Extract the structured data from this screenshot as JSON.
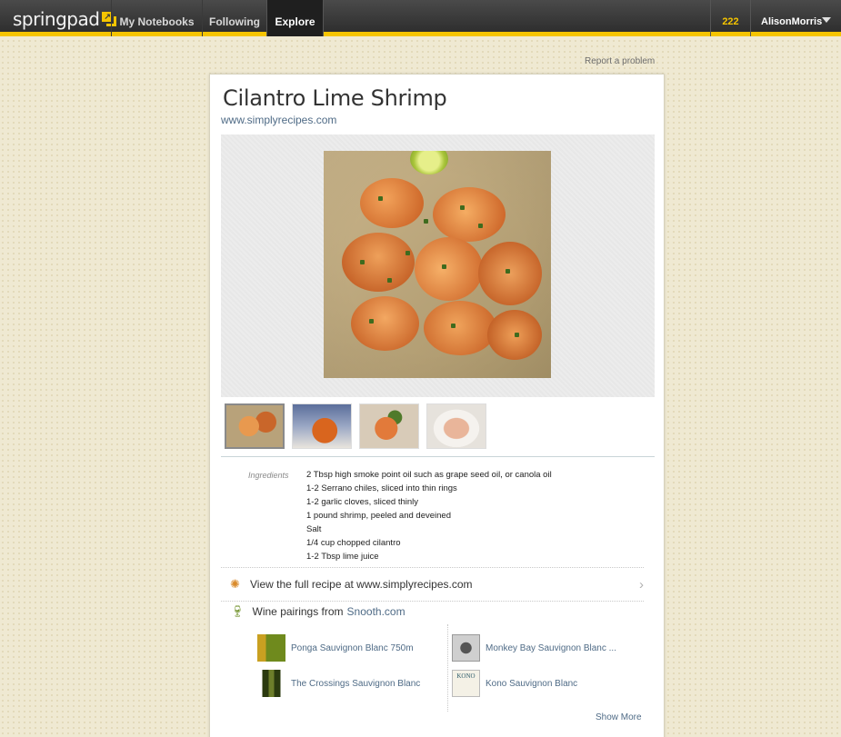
{
  "nav": {
    "logo_text": "springpad",
    "tabs": [
      {
        "label": "My Notebooks"
      },
      {
        "label": "Following"
      },
      {
        "label": "Explore",
        "active": true
      }
    ],
    "count": "222",
    "user": "AlisonMorris"
  },
  "page": {
    "report_link": "Report a problem",
    "title": "Cilantro Lime Shrimp",
    "source": "www.simplyrecipes.com"
  },
  "ingredients": {
    "label": "Ingredients",
    "items": [
      "2 Tbsp high smoke point oil such as grape seed oil, or canola oil",
      "1-2 Serrano chiles, sliced into thin rings",
      "1-2 garlic cloves, sliced thinly",
      "1 pound shrimp, peeled and deveined",
      "Salt",
      "1/4 cup chopped cilantro",
      "1-2 Tbsp lime juice"
    ]
  },
  "recipe_link": "View the full recipe at www.simplyrecipes.com",
  "wine": {
    "heading": "Wine pairings from",
    "source": "Snooth.com",
    "items": [
      "Ponga Sauvignon Blanc 750m",
      "Monkey Bay Sauvignon Blanc ...",
      "The Crossings Sauvignon Blanc",
      "Kono Sauvignon Blanc"
    ],
    "kono_label": "KONO",
    "show_more": "Show More"
  },
  "colors": {
    "accent": "#f5c400",
    "link": "#4f6b86",
    "background": "#efe9d2"
  }
}
